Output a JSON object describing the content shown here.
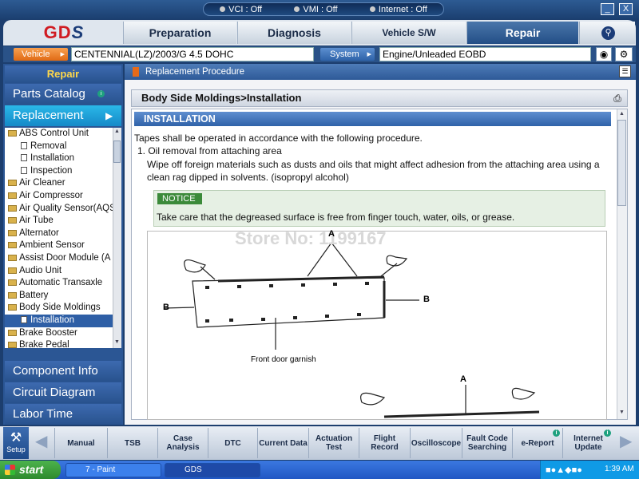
{
  "status": {
    "vci": "VCI : Off",
    "vmi": "VMI : Off",
    "internet": "Internet : Off"
  },
  "window": {
    "minimize": "_",
    "close": "X"
  },
  "logo": {
    "text_main": "GD",
    "text_accent": "S"
  },
  "tabs": [
    {
      "label": "Preparation"
    },
    {
      "label": "Diagnosis"
    },
    {
      "label": "Vehicle S/W Management"
    },
    {
      "label": "Repair"
    }
  ],
  "vehicle_row": {
    "vehicle_label": "Vehicle",
    "vehicle_value": "CENTENNIAL(LZ)/2003/G 4.5 DOHC",
    "system_label": "System",
    "system_value": "Engine/Unleaded EOBD"
  },
  "left": {
    "header": "Repair",
    "parts_catalog": "Parts Catalog",
    "replacement": "Replacement",
    "tree": [
      {
        "label": "ABS Control Unit",
        "level": 0,
        "kind": "folder"
      },
      {
        "label": "Removal",
        "level": 1,
        "kind": "doc"
      },
      {
        "label": "Installation",
        "level": 1,
        "kind": "doc"
      },
      {
        "label": "Inspection",
        "level": 1,
        "kind": "doc"
      },
      {
        "label": "Air Cleaner",
        "level": 0,
        "kind": "folder"
      },
      {
        "label": "Air Compressor",
        "level": 0,
        "kind": "folder"
      },
      {
        "label": "Air Quality Sensor(AQS",
        "level": 0,
        "kind": "folder"
      },
      {
        "label": "Air Tube",
        "level": 0,
        "kind": "folder"
      },
      {
        "label": "Alternator",
        "level": 0,
        "kind": "folder"
      },
      {
        "label": "Ambient Sensor",
        "level": 0,
        "kind": "folder"
      },
      {
        "label": "Assist Door Module (A",
        "level": 0,
        "kind": "folder"
      },
      {
        "label": "Audio Unit",
        "level": 0,
        "kind": "folder"
      },
      {
        "label": "Automatic Transaxle",
        "level": 0,
        "kind": "folder"
      },
      {
        "label": "Battery",
        "level": 0,
        "kind": "folder"
      },
      {
        "label": "Body Side Moldings",
        "level": 0,
        "kind": "folder"
      },
      {
        "label": "Installation",
        "level": 1,
        "kind": "doc",
        "selected": true
      },
      {
        "label": "Brake Booster",
        "level": 0,
        "kind": "folder"
      },
      {
        "label": "Brake Pedal",
        "level": 0,
        "kind": "folder"
      }
    ],
    "component_info": "Component Info",
    "circuit_diagram": "Circuit Diagram",
    "labor_time": "Labor Time"
  },
  "content": {
    "breadcrumb": "Replacement Procedure",
    "doc_title": "Body Side Moldings>Installation",
    "section_heading": "INSTALLATION",
    "intro": "Tapes shall be operated in accordance with the following procedure.",
    "step1_title": "1. Oil removal from attaching area",
    "step1_body": "Wipe off foreign materials such as dusts and oils that might affect adhesion from the attaching area using a clean rag dipped in solvents. (isopropyl alcohol)",
    "notice_label": "NOTICE",
    "notice_text": "Take care that the degreased surface is free from finger touch, water, oils, or grease.",
    "figure": {
      "watermark": "Store No: 1199167",
      "label_a": "A",
      "label_b": "B",
      "caption": "Front door garnish"
    }
  },
  "toolbar": {
    "setup": "Setup",
    "buttons": [
      "Manual",
      "TSB",
      "Case Analysis",
      "DTC",
      "Current Data",
      "Actuation Test",
      "Flight Record",
      "Oscilloscope",
      "Fault Code Searching",
      "e-Report",
      "Internet Update"
    ]
  },
  "taskbar": {
    "start": "start",
    "tasks": [
      "7 - Paint",
      "GDS"
    ],
    "clock": "1:39 AM"
  },
  "colors": {
    "accent_blue": "#2e5fa6",
    "logo_red": "#d01b22",
    "orange": "#e06a14",
    "notice_green": "#3b8a3a"
  }
}
